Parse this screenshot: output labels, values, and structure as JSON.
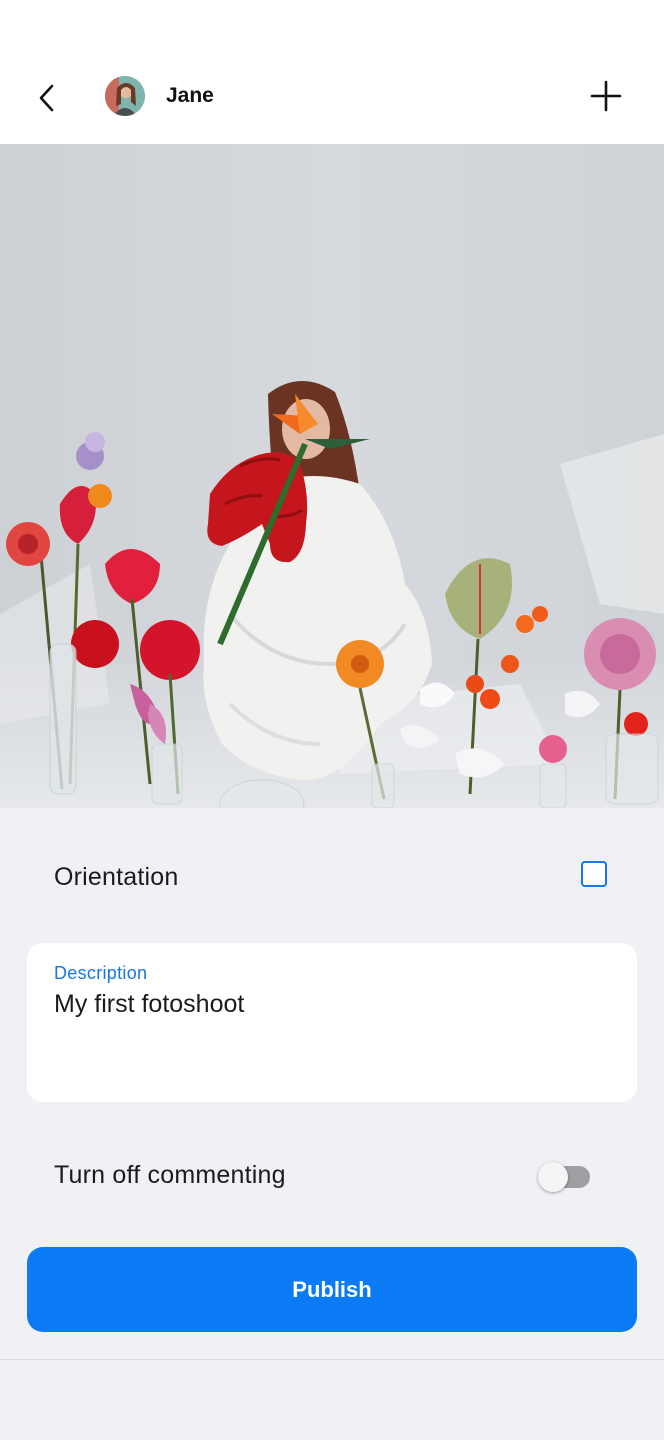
{
  "header": {
    "user_name": "Jane",
    "back_icon": "chevron-left-icon",
    "add_icon": "plus-icon"
  },
  "photo": {
    "subject": "photo"
  },
  "orientation": {
    "label": "Orientation",
    "checked": false
  },
  "description": {
    "label": "Description",
    "value": "My first fotoshoot"
  },
  "commenting": {
    "label": "Turn off commenting",
    "enabled": false
  },
  "publish": {
    "label": "Publish"
  },
  "colors": {
    "accent": "#1677e8",
    "button": "#0a7bf5",
    "background": "#f0f1f5"
  }
}
